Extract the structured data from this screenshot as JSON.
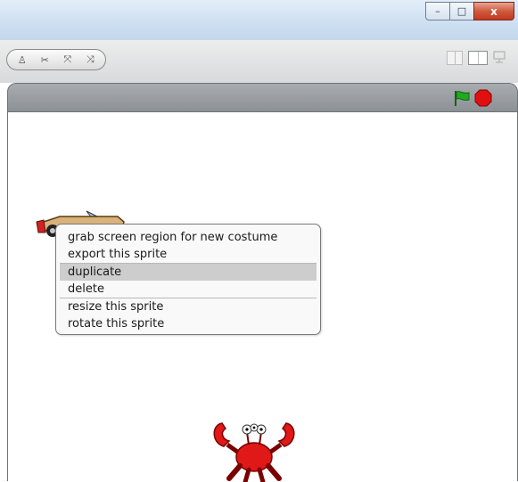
{
  "window": {
    "controls": {
      "minimize": "–",
      "maximize": "□",
      "close": "x"
    }
  },
  "toolbar": {
    "tools": [
      {
        "name": "duplicate-tool",
        "icon": "stamp-icon",
        "glyph": "♙"
      },
      {
        "name": "delete-tool",
        "icon": "scissors-icon",
        "glyph": "✂"
      },
      {
        "name": "grow-tool",
        "icon": "grow-icon",
        "glyph": "⤧"
      },
      {
        "name": "shrink-tool",
        "icon": "shrink-icon",
        "glyph": "⤨"
      }
    ]
  },
  "stage_header": {
    "flag_color": "#22a822",
    "stop_color": "#e01010"
  },
  "context_menu": {
    "items": [
      {
        "label": "grab screen region for new costume"
      },
      {
        "label": "export this sprite"
      },
      {
        "label": "duplicate"
      },
      {
        "label": "delete"
      },
      {
        "label": "resize this sprite"
      },
      {
        "label": "rotate this sprite"
      }
    ],
    "highlighted": "duplicate"
  },
  "sprites": [
    {
      "name": "car-sprite",
      "icon": "car-icon"
    },
    {
      "name": "crab-sprite",
      "icon": "crab-icon"
    }
  ]
}
